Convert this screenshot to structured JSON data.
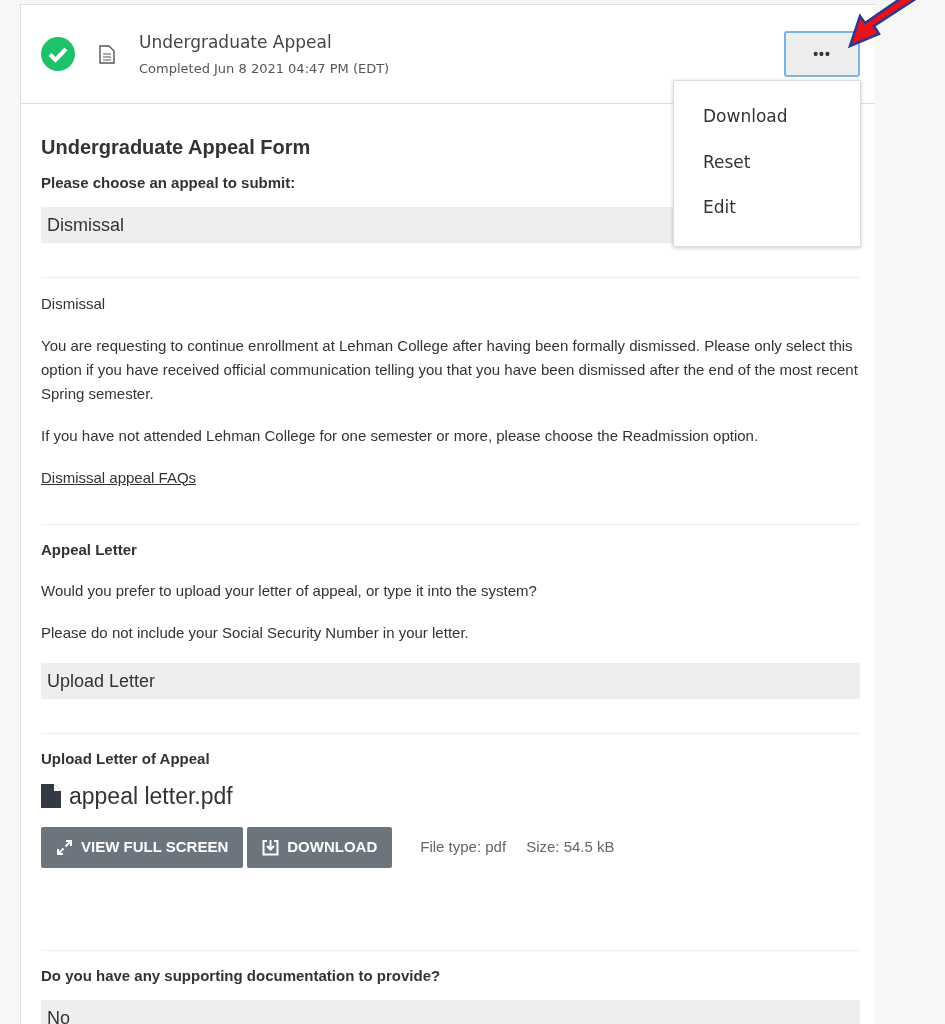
{
  "header": {
    "title": "Undergraduate Appeal",
    "subtitle": "Completed Jun 8 2021 04:47 PM (EDT)",
    "completed": true,
    "menu_button": "•••",
    "menu_open": true
  },
  "menu": [
    "Download",
    "Reset",
    "Edit"
  ],
  "form_title": "Undergraduate Appeal Form",
  "sections": [
    {
      "blocks": [
        {
          "kind": "label",
          "text": "Please choose an appeal to submit:"
        },
        {
          "kind": "answer",
          "text": "Dismissal"
        }
      ]
    },
    {
      "blocks": [
        {
          "kind": "text",
          "text": "Dismissal"
        },
        {
          "kind": "text",
          "text": "You are requesting to continue enrollment at Lehman College after having been formally dismissed. Please only select this option if you have received official communication telling you that you have been dismissed after the end of the most recent Spring semester."
        },
        {
          "kind": "text",
          "text": "If you have not attended Lehman College for one semester or more, please choose the Readmission option."
        },
        {
          "kind": "link",
          "text": "Dismissal appeal FAQs"
        }
      ]
    },
    {
      "blocks": [
        {
          "kind": "label",
          "text": "Appeal Letter"
        },
        {
          "kind": "text",
          "text": "Would you prefer to upload your letter of appeal, or type it into the system?"
        },
        {
          "kind": "text",
          "text": "Please do not include your Social Security Number in your letter."
        },
        {
          "kind": "answer",
          "text": "Upload Letter"
        }
      ]
    },
    {
      "blocks": [
        {
          "kind": "label",
          "text": "Upload Letter of Appeal"
        },
        {
          "kind": "file",
          "name": "appeal letter.pdf",
          "buttons": [
            {
              "kind": "expand",
              "label": "VIEW FULL SCREEN"
            },
            {
              "kind": "download",
              "label": "DOWNLOAD"
            }
          ],
          "file_type": "File type: pdf",
          "size": "Size: 54.5 kB"
        }
      ]
    },
    {
      "blocks": [
        {
          "kind": "label",
          "text": "Do you have any supporting documentation to provide?"
        },
        {
          "kind": "answer",
          "text": "No"
        }
      ]
    }
  ]
}
